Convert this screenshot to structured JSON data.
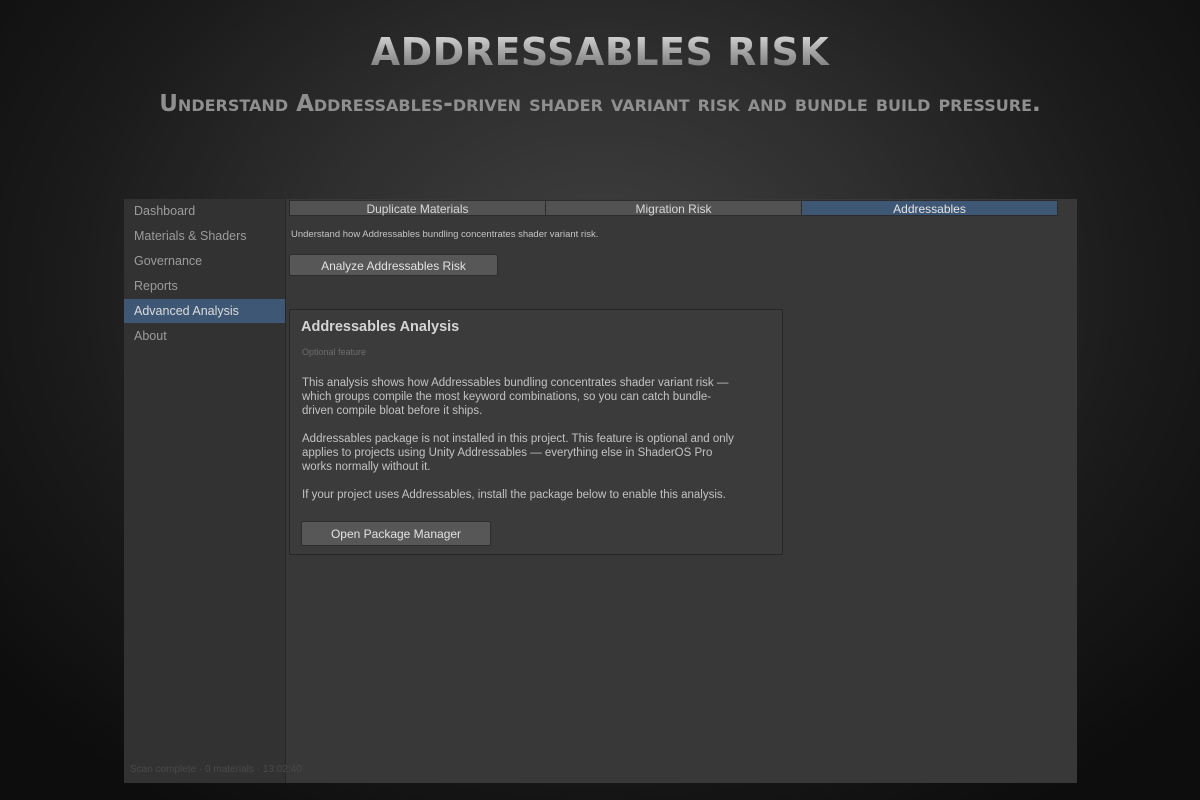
{
  "hero": {
    "title": "ADDRESSABLES RISK",
    "subtitle": "Understand Addressables-driven shader variant risk and bundle build pressure."
  },
  "sidebar": {
    "items": [
      {
        "label": "Dashboard",
        "active": false
      },
      {
        "label": "Materials & Shaders",
        "active": false
      },
      {
        "label": "Governance",
        "active": false
      },
      {
        "label": "Reports",
        "active": false
      },
      {
        "label": "Advanced Analysis",
        "active": true
      },
      {
        "label": "About",
        "active": false
      }
    ]
  },
  "tabs": [
    {
      "label": "Duplicate Materials",
      "active": false
    },
    {
      "label": "Migration Risk",
      "active": false
    },
    {
      "label": "Addressables",
      "active": true
    }
  ],
  "panel": {
    "intro": "Understand how Addressables bundling concentrates shader variant risk.",
    "analyze_button": "Analyze Addressables Risk"
  },
  "card": {
    "title": "Addressables Analysis",
    "badge": "Optional feature",
    "paragraph1": [
      "This analysis shows how Addressables bundling concentrates shader variant risk —",
      "which groups compile the most keyword combinations, so you can catch bundle-",
      "driven compile bloat before it ships."
    ],
    "paragraph2": [
      "Addressables package is not installed in this project. This feature is optional and only",
      "applies to projects using Unity Addressables — everything else in ShaderOS Pro",
      "works normally without it."
    ],
    "paragraph3": [
      "If your project uses Addressables, install the package below to enable this analysis."
    ],
    "package_button": "Open Package Manager"
  },
  "statusbar": {
    "text": "Scan complete · 0 materials · 13:02:40"
  },
  "colors": {
    "accent": "#3e5775",
    "panel_bg": "#383838",
    "sidebar_bg": "#323232"
  }
}
